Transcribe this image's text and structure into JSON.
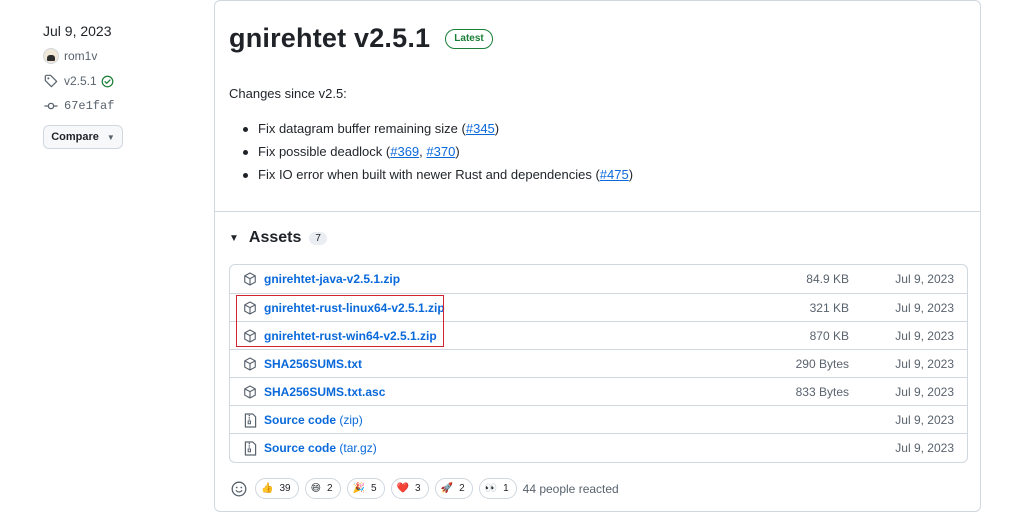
{
  "meta": {
    "date": "Jul 9, 2023",
    "author": "rom1v",
    "tag": "v2.5.1",
    "commit": "67e1faf",
    "compare_label": "Compare",
    "icons": {
      "tag": "tag-icon",
      "verified": "check-circle-icon",
      "commit": "git-commit-icon",
      "caret": "triangle-down-icon"
    }
  },
  "release": {
    "title": "gnirehtet v2.5.1",
    "latest_label": "Latest",
    "changes_intro": "Changes since v2.5:",
    "changes": [
      {
        "text": "Fix datagram buffer remaining size (",
        "link": "#345",
        "after": ")"
      },
      {
        "text": "Fix possible deadlock (",
        "link": "#369",
        "sep": ", ",
        "link2": "#370",
        "after": ")"
      },
      {
        "text": "Fix IO error when built with newer Rust and dependencies (",
        "link": "#475",
        "after": ")"
      }
    ]
  },
  "assets": {
    "label": "Assets",
    "count": "7",
    "items": [
      {
        "name": "gnirehtet-java-v2.5.1.zip",
        "size": "84.9 KB",
        "date": "Jul 9, 2023",
        "icon": "package-icon"
      },
      {
        "name": "gnirehtet-rust-linux64-v2.5.1.zip",
        "size": "321 KB",
        "date": "Jul 9, 2023",
        "icon": "package-icon"
      },
      {
        "name": "gnirehtet-rust-win64-v2.5.1.zip",
        "size": "870 KB",
        "date": "Jul 9, 2023",
        "icon": "package-icon"
      },
      {
        "name": "SHA256SUMS.txt",
        "size": "290 Bytes",
        "date": "Jul 9, 2023",
        "icon": "package-icon"
      },
      {
        "name": "SHA256SUMS.txt.asc",
        "size": "833 Bytes",
        "date": "Jul 9, 2023",
        "icon": "package-icon"
      },
      {
        "name": "Source code",
        "ext": "(zip)",
        "size": "",
        "date": "Jul 9, 2023",
        "icon": "file-zip-icon"
      },
      {
        "name": "Source code",
        "ext": "(tar.gz)",
        "size": "",
        "date": "Jul 9, 2023",
        "icon": "file-zip-icon"
      }
    ]
  },
  "reactions": {
    "items": [
      {
        "emoji": "👍",
        "count": "39"
      },
      {
        "emoji": "😄",
        "count": "2"
      },
      {
        "emoji": "🎉",
        "count": "5"
      },
      {
        "emoji": "❤️",
        "count": "3"
      },
      {
        "emoji": "🚀",
        "count": "2"
      },
      {
        "emoji": "👀",
        "count": "1"
      }
    ],
    "summary": "44 people reacted"
  },
  "colors": {
    "link": "#0969da",
    "latest": "#1a7f37",
    "highlight": "#d1242f",
    "muted": "#59636e",
    "border": "#d0d7de"
  }
}
